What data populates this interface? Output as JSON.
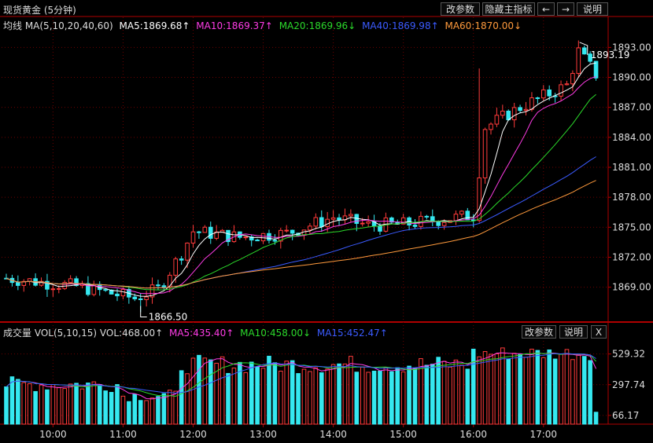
{
  "header": {
    "title": "现货黄金 (5分钟)",
    "buttons": {
      "params": "改参数",
      "hide_indicator": "隐藏主指标",
      "prev": "←",
      "next": "→",
      "help": "说明"
    }
  },
  "ma_legend": {
    "label": "均线 MA(5,10,20,40,60)",
    "items": [
      {
        "text": "MA5:1869.68↑",
        "color": "#ffffff"
      },
      {
        "text": "MA10:1869.37↑",
        "color": "#ff3ce6"
      },
      {
        "text": "MA20:1869.96↓",
        "color": "#2bd92b"
      },
      {
        "text": "MA40:1869.98↑",
        "color": "#3b5bff"
      },
      {
        "text": "MA60:1870.00↓",
        "color": "#ff9a3c"
      }
    ]
  },
  "vol_header": {
    "label": "成交量 VOL(5,10,15) VOL:468.00↑",
    "items": [
      {
        "text": "MA5:435.40↑",
        "color": "#ff3ce6"
      },
      {
        "text": "MA10:458.00↓",
        "color": "#2bd92b"
      },
      {
        "text": "MA15:452.47↑",
        "color": "#3b5bff"
      }
    ],
    "buttons": {
      "params": "改参数",
      "help": "说明",
      "close": "X"
    }
  },
  "colors": {
    "up": "#ff3b3b",
    "down": "#35e8f0",
    "grid": "#6b0000",
    "axis": "#b00000",
    "text": "#dddddd"
  },
  "chart_data": [
    {
      "type": "candlestick",
      "title": "现货黄金 (5分钟)",
      "y_ticks": [
        1869.0,
        1872.0,
        1875.0,
        1878.0,
        1881.0,
        1884.0,
        1887.0,
        1890.0,
        1893.0
      ],
      "y_tick_labels": [
        "1869.00",
        "1872.00",
        "1875.00",
        "1878.00",
        "1881.00",
        "1884.00",
        "1887.00",
        "1890.00",
        "1893.00"
      ],
      "ylim": [
        1866.3,
        1894.6
      ],
      "x_ticks": [
        {
          "label": "10:00",
          "index": 8
        },
        {
          "label": "11:00",
          "index": 20
        },
        {
          "label": "12:00",
          "index": 32
        },
        {
          "label": "13:00",
          "index": 44
        },
        {
          "label": "14:00",
          "index": 56
        },
        {
          "label": "15:00",
          "index": 68
        },
        {
          "label": "16:00",
          "index": 80
        },
        {
          "label": "17:00",
          "index": 92
        }
      ],
      "annotations": [
        {
          "text": "1866.50",
          "index": 23,
          "value": 1866.5
        },
        {
          "text": "1893.19",
          "index": 99,
          "value": 1893.19
        }
      ],
      "close_end": 1890.3,
      "ma_end": {
        "MA5": 1890.0,
        "MA10": 1888.2,
        "MA20": 1884.5,
        "MA40": 1879.8,
        "MA60": 1877.6
      },
      "ma_periods": [
        5,
        10,
        20,
        40,
        60
      ],
      "first_close": 1869.9
    },
    {
      "type": "bar",
      "title": "成交量 VOL(5,10,15)",
      "y_ticks": [
        66.17,
        297.74,
        529.32
      ],
      "y_tick_labels": [
        "66.17",
        "297.74",
        "529.32"
      ],
      "ylim": [
        0,
        640
      ],
      "last_value": 90,
      "vol_ma_periods": [
        5,
        10,
        15
      ]
    }
  ]
}
